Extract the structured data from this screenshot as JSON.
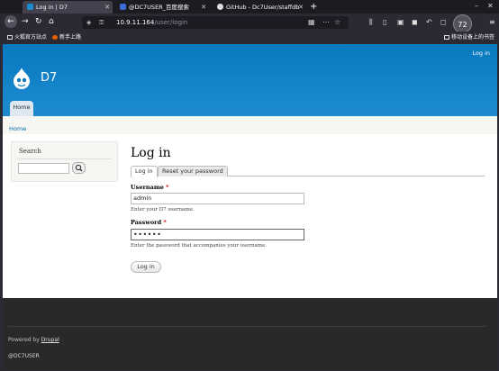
{
  "browser": {
    "tabs": [
      {
        "title": "Log in | D7",
        "active": true
      },
      {
        "title": "@DC7USER_百度搜索",
        "active": false
      },
      {
        "title": "GitHub - Dc7User/staffdb",
        "active": false
      }
    ],
    "url_host": "10.9.11.164",
    "url_path": "/user/login",
    "badge": "72",
    "bookmarks": [
      "火狐官方站点",
      "新手上路"
    ],
    "mobile_bookmarks": "移动设备上的书签"
  },
  "site": {
    "name": "D7",
    "secondary_link": "Log in",
    "main_menu": [
      "Home"
    ],
    "breadcrumb": "Home",
    "brand_color": "#0779bf"
  },
  "sidebar": {
    "block_title": "Search",
    "search_value": ""
  },
  "page": {
    "title": "Log in",
    "tabs": [
      "Log in",
      "Reset your password"
    ],
    "username_label": "Username",
    "username_value": "admin",
    "username_desc": "Enter your D7 username.",
    "password_label": "Password",
    "password_value": "••••••",
    "password_desc": "Enter the password that accompanies your username.",
    "required_marker": "*",
    "submit_label": "Log in"
  },
  "footer": {
    "powered_prefix": "Powered by ",
    "powered_link": "Drupal",
    "id_text": "@DC7USER"
  }
}
